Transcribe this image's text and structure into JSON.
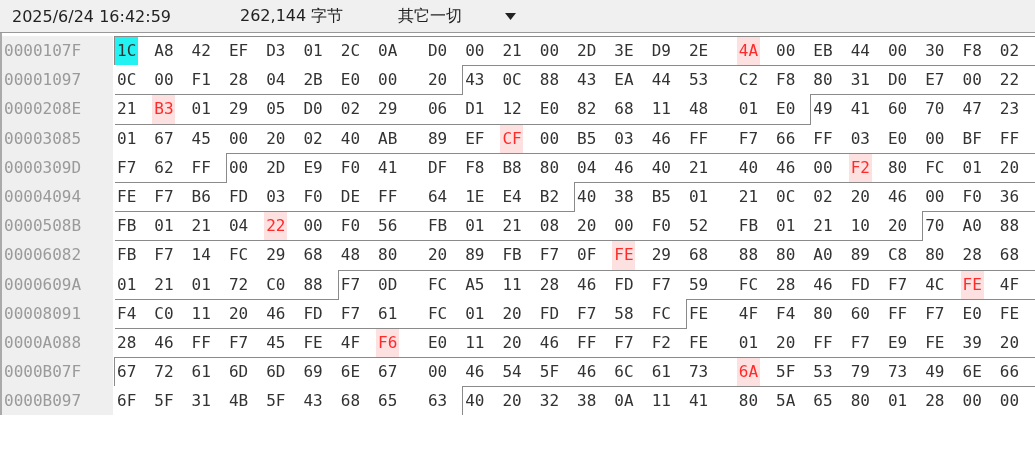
{
  "toolbar": {
    "timestamp": "2025/6/24 16:42:59",
    "size": "262,144 字节",
    "filter": {
      "value": "其它一切"
    }
  },
  "rows": [
    {
      "address": "0000107F",
      "runs": [
        {
          "cursor": true,
          "changed": false,
          "block_start": true,
          "bytes": [
            "1C"
          ]
        },
        {
          "cursor": false,
          "changed": false,
          "block_start": false,
          "bytes": [
            "A8",
            "42",
            "EF",
            "D3",
            "01",
            "2C",
            "0A",
            "D0",
            "00",
            "21",
            "00",
            "2D",
            "3E",
            "D9",
            "2E"
          ]
        },
        {
          "cursor": false,
          "changed": true,
          "block_start": false,
          "bytes": [
            "4A"
          ]
        },
        {
          "cursor": false,
          "changed": false,
          "block_start": false,
          "bytes": [
            "00",
            "EB",
            "44",
            "00",
            "30",
            "F8",
            "02"
          ]
        }
      ]
    },
    {
      "address": "00001097",
      "runs": [
        {
          "cursor": false,
          "changed": false,
          "block_start": false,
          "bytes": [
            "0C",
            "00",
            "F1",
            "28",
            "04",
            "2B",
            "E0",
            "00",
            "20"
          ]
        },
        {
          "cursor": false,
          "changed": false,
          "block_start": true,
          "bytes": [
            "43",
            "0C",
            "88",
            "43",
            "EA",
            "44",
            "53",
            "C2",
            "F8",
            "80",
            "31",
            "D0",
            "E7",
            "00",
            "22"
          ]
        }
      ]
    },
    {
      "address": "0000208E",
      "runs": [
        {
          "cursor": false,
          "changed": false,
          "block_start": false,
          "bytes": [
            "21"
          ]
        },
        {
          "cursor": false,
          "changed": true,
          "block_start": false,
          "bytes": [
            "B3"
          ]
        },
        {
          "cursor": false,
          "changed": false,
          "block_start": false,
          "bytes": [
            "01",
            "29",
            "05",
            "D0",
            "02",
            "29",
            "06",
            "D1",
            "12",
            "E0",
            "82",
            "68",
            "11",
            "48",
            "01",
            "E0"
          ]
        },
        {
          "cursor": false,
          "changed": false,
          "block_start": true,
          "bytes": [
            "49",
            "41",
            "60",
            "70",
            "47",
            "23"
          ]
        }
      ]
    },
    {
      "address": "00003085",
      "runs": [
        {
          "cursor": false,
          "changed": false,
          "block_start": false,
          "bytes": [
            "01",
            "67",
            "45",
            "00",
            "20",
            "02",
            "40",
            "AB",
            "89",
            "EF"
          ]
        },
        {
          "cursor": false,
          "changed": true,
          "block_start": false,
          "bytes": [
            "CF"
          ]
        },
        {
          "cursor": false,
          "changed": false,
          "block_start": false,
          "bytes": [
            "00",
            "B5",
            "03",
            "46",
            "FF",
            "F7",
            "66",
            "FF",
            "03",
            "E0",
            "00",
            "BF",
            "FF"
          ]
        }
      ]
    },
    {
      "address": "0000309D",
      "runs": [
        {
          "cursor": false,
          "changed": false,
          "block_start": false,
          "bytes": [
            "F7",
            "62",
            "FF"
          ]
        },
        {
          "cursor": false,
          "changed": false,
          "block_start": true,
          "bytes": [
            "00",
            "2D",
            "E9",
            "F0",
            "41",
            "DF",
            "F8",
            "B8",
            "80",
            "04",
            "46",
            "40",
            "21",
            "40",
            "46",
            "00"
          ]
        },
        {
          "cursor": false,
          "changed": true,
          "block_start": false,
          "bytes": [
            "F2"
          ]
        },
        {
          "cursor": false,
          "changed": false,
          "block_start": false,
          "bytes": [
            "80",
            "FC",
            "01",
            "20"
          ]
        }
      ]
    },
    {
      "address": "00004094",
      "runs": [
        {
          "cursor": false,
          "changed": false,
          "block_start": false,
          "bytes": [
            "FE",
            "F7",
            "B6",
            "FD",
            "03",
            "F0",
            "DE",
            "FF",
            "64",
            "1E",
            "E4",
            "B2"
          ]
        },
        {
          "cursor": false,
          "changed": false,
          "block_start": true,
          "bytes": [
            "40",
            "38",
            "B5",
            "01",
            "21",
            "0C",
            "02",
            "20",
            "46",
            "00",
            "F0",
            "36"
          ]
        }
      ]
    },
    {
      "address": "0000508B",
      "runs": [
        {
          "cursor": false,
          "changed": false,
          "block_start": false,
          "bytes": [
            "FB",
            "01",
            "21",
            "04"
          ]
        },
        {
          "cursor": false,
          "changed": true,
          "block_start": false,
          "bytes": [
            "22"
          ]
        },
        {
          "cursor": false,
          "changed": false,
          "block_start": false,
          "bytes": [
            "00",
            "F0",
            "56",
            "FB",
            "01",
            "21",
            "08",
            "20",
            "00",
            "F0",
            "52",
            "FB",
            "01",
            "21",
            "10",
            "20"
          ]
        },
        {
          "cursor": false,
          "changed": false,
          "block_start": true,
          "bytes": [
            "70",
            "A0",
            "88"
          ]
        }
      ]
    },
    {
      "address": "00006082",
      "runs": [
        {
          "cursor": false,
          "changed": false,
          "block_start": false,
          "bytes": [
            "FB",
            "F7",
            "14",
            "FC",
            "29",
            "68",
            "48",
            "80",
            "20",
            "89",
            "FB",
            "F7",
            "0F"
          ]
        },
        {
          "cursor": false,
          "changed": true,
          "block_start": false,
          "bytes": [
            "FE"
          ]
        },
        {
          "cursor": false,
          "changed": false,
          "block_start": false,
          "bytes": [
            "29",
            "68",
            "88",
            "80",
            "A0",
            "89",
            "C8",
            "80",
            "28",
            "68"
          ]
        }
      ]
    },
    {
      "address": "0000609A",
      "runs": [
        {
          "cursor": false,
          "changed": false,
          "block_start": false,
          "bytes": [
            "01",
            "21",
            "01",
            "72",
            "C0",
            "88"
          ]
        },
        {
          "cursor": false,
          "changed": false,
          "block_start": true,
          "bytes": [
            "F7",
            "0D",
            "FC",
            "A5",
            "11",
            "28",
            "46",
            "FD",
            "F7",
            "59",
            "FC",
            "28",
            "46",
            "FD",
            "F7",
            "4C"
          ]
        },
        {
          "cursor": false,
          "changed": true,
          "block_start": false,
          "bytes": [
            "FE"
          ]
        },
        {
          "cursor": false,
          "changed": false,
          "block_start": false,
          "bytes": [
            "4F"
          ]
        }
      ]
    },
    {
      "address": "00008091",
      "runs": [
        {
          "cursor": false,
          "changed": false,
          "block_start": false,
          "bytes": [
            "F4",
            "C0",
            "11",
            "20",
            "46",
            "FD",
            "F7",
            "61",
            "FC",
            "01",
            "20",
            "FD",
            "F7",
            "58",
            "FC"
          ]
        },
        {
          "cursor": false,
          "changed": false,
          "block_start": true,
          "bytes": [
            "FE",
            "4F",
            "F4",
            "80",
            "60",
            "FF",
            "F7",
            "E0",
            "FE"
          ]
        }
      ]
    },
    {
      "address": "0000A088",
      "runs": [
        {
          "cursor": false,
          "changed": false,
          "block_start": false,
          "bytes": [
            "28",
            "46",
            "FF",
            "F7",
            "45",
            "FE",
            "4F"
          ]
        },
        {
          "cursor": false,
          "changed": true,
          "block_start": false,
          "bytes": [
            "F6"
          ]
        },
        {
          "cursor": false,
          "changed": false,
          "block_start": false,
          "bytes": [
            "E0",
            "11",
            "20",
            "46",
            "FF",
            "F7",
            "F2",
            "FE",
            "01",
            "20",
            "FF",
            "F7",
            "E9",
            "FE",
            "39",
            "20"
          ]
        }
      ]
    },
    {
      "address": "0000B07F",
      "runs": [
        {
          "cursor": false,
          "changed": false,
          "block_start": true,
          "bytes": [
            "67",
            "72",
            "61",
            "6D",
            "6D",
            "69",
            "6E",
            "67",
            "00",
            "46",
            "54",
            "5F",
            "46",
            "6C",
            "61",
            "73"
          ]
        },
        {
          "cursor": false,
          "changed": true,
          "block_start": false,
          "bytes": [
            "6A"
          ]
        },
        {
          "cursor": false,
          "changed": false,
          "block_start": false,
          "bytes": [
            "5F",
            "53",
            "79",
            "73",
            "49",
            "6E",
            "66"
          ]
        }
      ]
    },
    {
      "address": "0000B097",
      "runs": [
        {
          "cursor": false,
          "changed": false,
          "block_start": false,
          "bytes": [
            "6F",
            "5F",
            "31",
            "4B",
            "5F",
            "43",
            "68",
            "65",
            "63"
          ]
        },
        {
          "cursor": false,
          "changed": false,
          "block_start": true,
          "bytes": [
            "40",
            "20",
            "32",
            "38",
            "0A",
            "11",
            "41",
            "80",
            "5A",
            "65",
            "80",
            "01",
            "28",
            "00",
            "00"
          ]
        }
      ]
    }
  ]
}
